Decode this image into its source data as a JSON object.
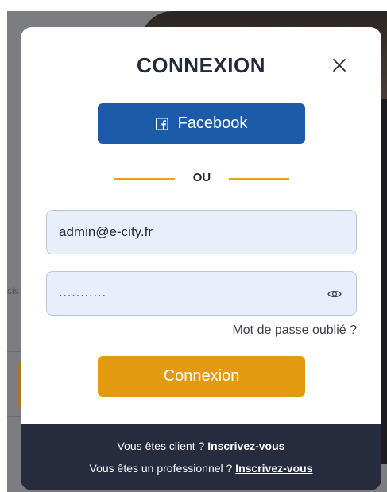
{
  "background": {
    "partial_text": "cis"
  },
  "modal": {
    "title": "CONNEXION",
    "facebook_label": "Facebook",
    "divider_label": "OU",
    "email": {
      "value": "admin@e-city.fr"
    },
    "password": {
      "masked_value": "..........."
    },
    "forgot_label": "Mot de passe oublié ?",
    "submit_label": "Connexion",
    "footer": {
      "client_prompt": "Vous êtes client ?",
      "client_link": "Inscrivez-vous",
      "pro_prompt": "Vous êtes un professionnel ?",
      "pro_link": "Inscrivez-vous"
    }
  },
  "colors": {
    "facebook_blue": "#1c5ba8",
    "accent_orange": "#e29a10",
    "divider_orange": "#e3a21a",
    "footer_navy": "#262c3e",
    "field_bg": "#e8effa"
  },
  "icons": [
    "close-icon",
    "facebook-icon",
    "eye-icon"
  ]
}
